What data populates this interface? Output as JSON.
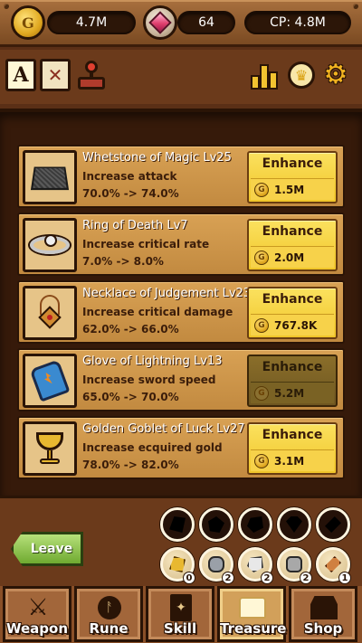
{
  "resources": {
    "gold": "4.7M",
    "gold_icon_letter": "G",
    "gems": "64",
    "cp": "CP: 4.8M"
  },
  "top_icons": {
    "book_a_letter": "A"
  },
  "treasures": [
    {
      "name": "Whetstone of Magic Lv25",
      "desc": "Increase attack",
      "pct": "70.0% -> 74.0%",
      "enhance": "Enhance",
      "cost": "1.5M",
      "icon": "whetstone-icon",
      "enabled": true
    },
    {
      "name": "Ring of Death Lv7",
      "desc": "Increase critical rate",
      "pct": "7.0% -> 8.0%",
      "enhance": "Enhance",
      "cost": "2.0M",
      "icon": "skull-ring-icon",
      "enabled": true
    },
    {
      "name": "Necklace of Judgement Lv23",
      "desc": "Increase critical damage",
      "pct": "62.0% -> 66.0%",
      "enhance": "Enhance",
      "cost": "767.8K",
      "icon": "necklace-icon",
      "enabled": true
    },
    {
      "name": "Glove of Lightning Lv13",
      "desc": "Increase sword speed",
      "pct": "65.0% -> 70.0%",
      "enhance": "Enhance",
      "cost": "5.2M",
      "icon": "glove-icon",
      "enabled": false
    },
    {
      "name": "Golden Goblet of Luck Lv27",
      "desc": "Increase ecquired gold",
      "pct": "78.0% -> 82.0%",
      "enhance": "Enhance",
      "cost": "3.1M",
      "icon": "goblet-icon",
      "enabled": true
    }
  ],
  "coin_letter": "G",
  "leave_label": "Leave",
  "gem_slots_empty": [
    {
      "icon": "empty-gem-slot-icon"
    },
    {
      "icon": "empty-gem-slot-icon"
    },
    {
      "icon": "empty-gem-slot-icon"
    },
    {
      "icon": "empty-gem-slot-icon"
    },
    {
      "icon": "empty-gem-slot-icon"
    }
  ],
  "gem_slots_owned": [
    {
      "icon": "gold-ore-icon",
      "count": "0",
      "color": "#e8b830"
    },
    {
      "icon": "iron-ore-icon",
      "count": "2",
      "color": "#9aa0a8"
    },
    {
      "icon": "silver-ore-icon",
      "count": "2",
      "color": "#e8e8e8"
    },
    {
      "icon": "stone-ore-icon",
      "count": "2",
      "color": "#a8a8a8"
    },
    {
      "icon": "copper-ore-icon",
      "count": "1",
      "color": "#d08040"
    }
  ],
  "nav": [
    {
      "label": "Weapon",
      "icon": "swords-icon"
    },
    {
      "label": "Rune",
      "icon": "rune-icon"
    },
    {
      "label": "Skill",
      "icon": "skill-book-icon"
    },
    {
      "label": "Treasure",
      "icon": "treasure-chest-icon",
      "active": true
    },
    {
      "label": "Shop",
      "icon": "shop-icon"
    }
  ]
}
